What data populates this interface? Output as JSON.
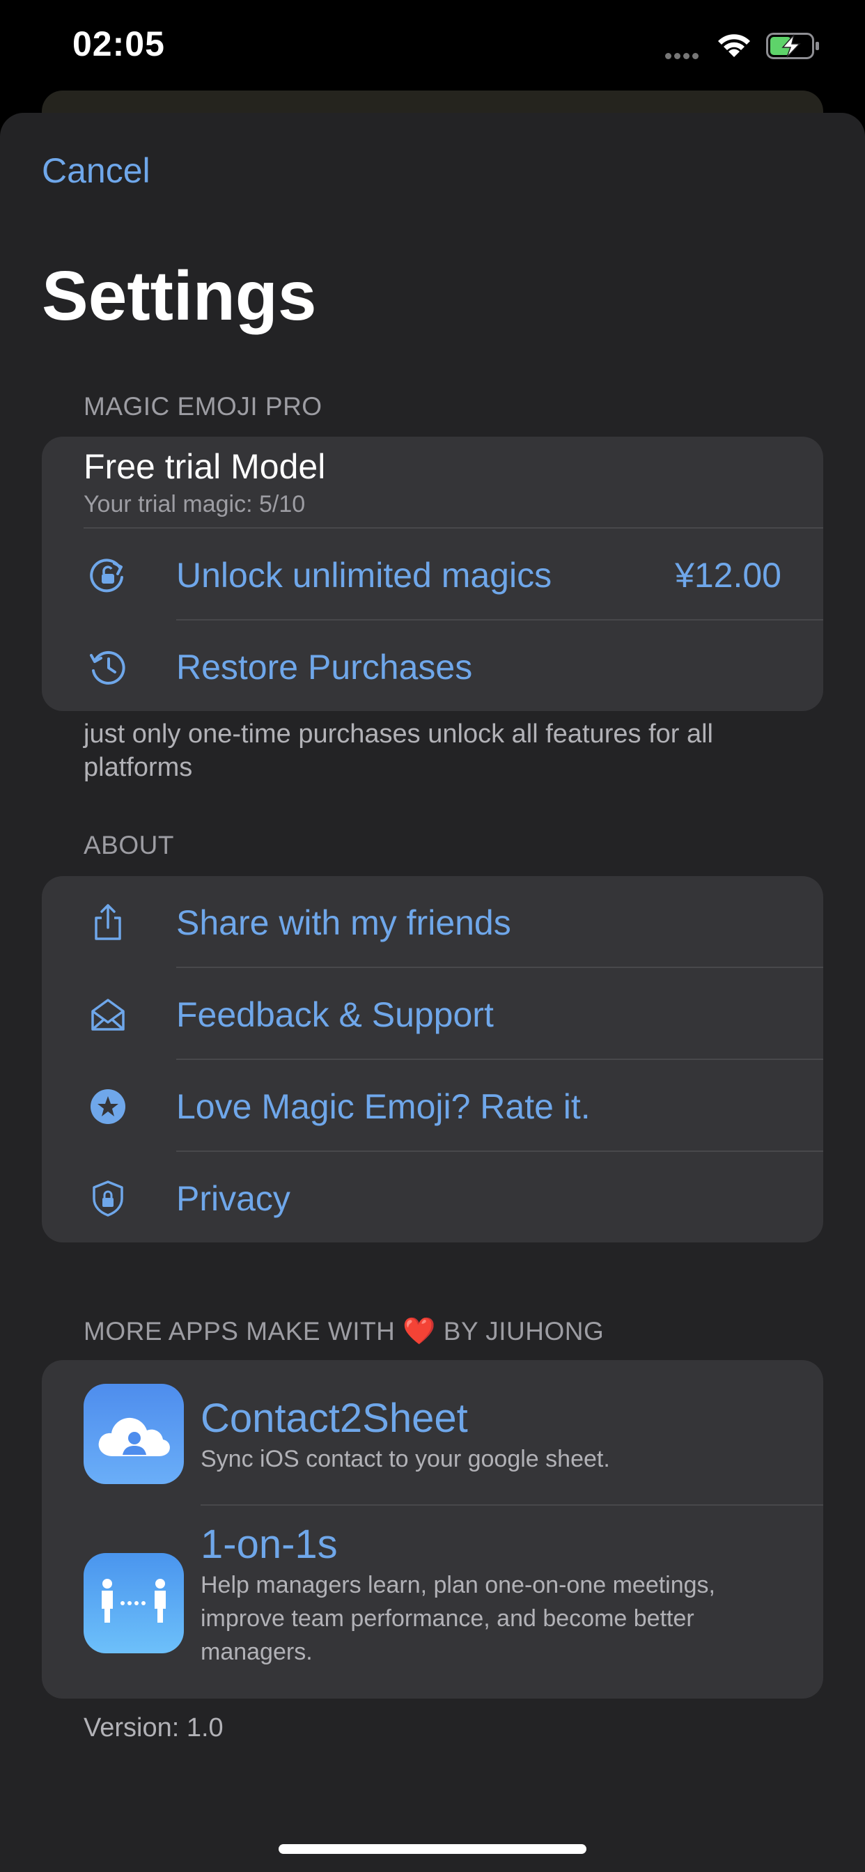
{
  "status_bar": {
    "time": "02:05",
    "icons": [
      "signal-dots-icon",
      "wifi-icon",
      "battery-charging-icon"
    ]
  },
  "nav": {
    "cancel_label": "Cancel",
    "title": "Settings"
  },
  "pro_section": {
    "header": "MAGIC EMOJI PRO",
    "trial_title": "Free trial Model",
    "trial_subtitle": "Your trial magic: 5/10",
    "unlock_label": "Unlock unlimited magics",
    "unlock_price": "¥12.00",
    "unlock_icon": "unlock-rotate-icon",
    "restore_label": "Restore Purchases",
    "restore_icon": "clock-history-icon",
    "footer": "just only one-time purchases unlock all features  for all platforms"
  },
  "about_section": {
    "header": "ABOUT",
    "items": [
      {
        "label": "Share with my friends",
        "icon": "share-icon"
      },
      {
        "label": "Feedback & Support",
        "icon": "envelope-icon"
      },
      {
        "label": "Love Magic Emoji? Rate it.",
        "icon": "star-circle-icon"
      },
      {
        "label": "Privacy",
        "icon": "shield-lock-icon"
      }
    ]
  },
  "apps_section": {
    "header_prefix": "MORE APPS MAKE WITH",
    "header_emoji": "❤️",
    "header_suffix": "BY JIUHONG",
    "apps": [
      {
        "name": "Contact2Sheet",
        "description": "Sync iOS contact to your google sheet.",
        "icon": "cloud-person-icon"
      },
      {
        "name": "1-on-1s",
        "description": "Help managers learn, plan one-on-one meetings, improve team performance, and become better managers.",
        "icon": "two-people-icon"
      }
    ]
  },
  "version": "Version: 1.0",
  "colors": {
    "accent": "#6fa7ea",
    "sheet_background": "#232325",
    "group_background": "#353538",
    "secondary_text": "#9d9da3"
  }
}
